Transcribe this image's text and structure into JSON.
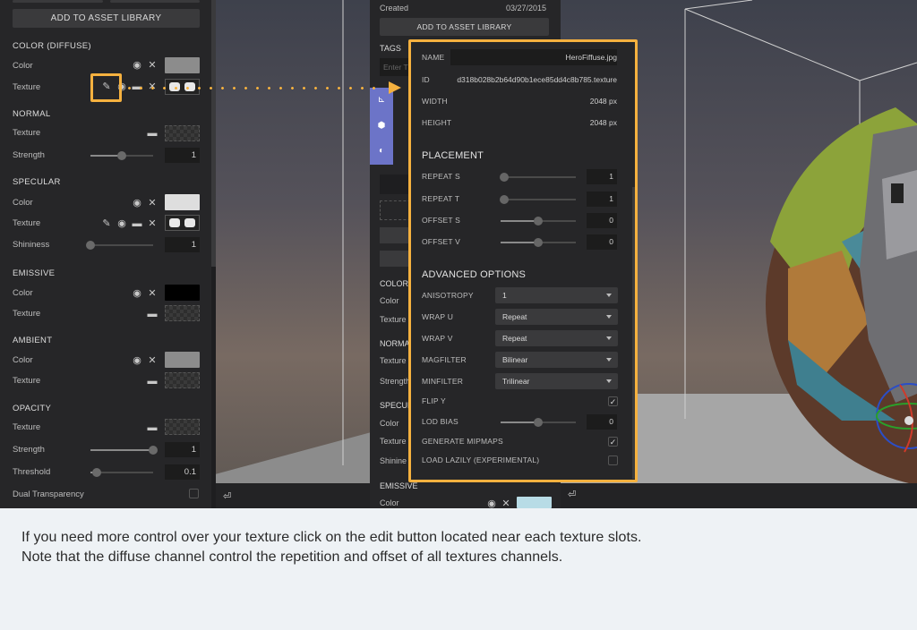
{
  "left_panel": {
    "add_to_library": "ADD TO ASSET LIBRARY",
    "sections": {
      "color_diffuse": "COLOR (DIFFUSE)",
      "normal": "NORMAL",
      "specular": "SPECULAR",
      "emissive": "EMISSIVE",
      "ambient": "AMBIENT",
      "opacity": "OPACITY"
    },
    "labels": {
      "color": "Color",
      "texture": "Texture",
      "strength": "Strength",
      "shininess": "Shininess",
      "threshold": "Threshold",
      "dual_transparency": "Dual Transparency"
    },
    "values": {
      "normal_strength": "1",
      "specular_shininess": "1",
      "opacity_strength": "1",
      "opacity_threshold": "0.1"
    },
    "slider_levels": {
      "normal_strength": 0.5,
      "specular_shininess": 0.0,
      "opacity_strength": 1.0,
      "opacity_threshold": 0.1
    },
    "swatch_colors": {
      "diffuse": "#8c8c8c",
      "specular": "#dedede",
      "emissive": "#000000",
      "ambient": "#8c8c8c"
    }
  },
  "middle_panel": {
    "created_label": "Created",
    "created_date": "03/27/2015",
    "add_to_library": "ADD TO ASSET LIBRARY",
    "tags_label": "TAGS",
    "tags_placeholder": "Enter T",
    "fragments": {
      "color": "COLOR",
      "color_row": "Color",
      "texture": "Texture",
      "normal": "NORMA",
      "texture2": "Texture",
      "strength": "Strength",
      "specular": "SPECUL",
      "color2": "Color",
      "texture3": "Texture",
      "shininess": "Shinine",
      "emissive": "EMISSIVE",
      "emissive_color": "Color"
    },
    "side_icons": [
      "axis-icon",
      "cube-icon",
      "material-icon"
    ]
  },
  "texture_popup": {
    "name_label": "NAME",
    "name_value": "HeroFiffuse.jpg",
    "id_label": "ID",
    "id_value": "d318b028b2b64d90b1ece85dd4c8b785.texture",
    "width_label": "WIDTH",
    "width_value": "2048 px",
    "height_label": "HEIGHT",
    "height_value": "2048 px",
    "placement_title": "PLACEMENT",
    "repeat_s_label": "REPEAT S",
    "repeat_s_value": "1",
    "repeat_t_label": "REPEAT T",
    "repeat_t_value": "1",
    "offset_s_label": "OFFSET S",
    "offset_s_value": "0",
    "offset_v_label": "OFFSET V",
    "offset_v_value": "0",
    "advanced_title": "ADVANCED OPTIONS",
    "anisotropy_label": "ANISOTROPY",
    "anisotropy_value": "1",
    "wrap_u_label": "WRAP U",
    "wrap_u_value": "Repeat",
    "wrap_v_label": "WRAP V",
    "wrap_v_value": "Repeat",
    "magfilter_label": "MAGFILTER",
    "magfilter_value": "Bilinear",
    "minfilter_label": "MINFILTER",
    "minfilter_value": "Trilinear",
    "flip_y_label": "FLIP Y",
    "flip_y_checked": true,
    "lod_bias_label": "LOD BIAS",
    "lod_bias_value": "0",
    "generate_mipmaps_label": "GENERATE MIPMAPS",
    "generate_mipmaps_checked": true,
    "load_lazily_label": "LOAD LAZILY (EXPERIMENTAL)",
    "load_lazily_checked": false,
    "check_glyph": "✓"
  },
  "caption": {
    "line1": "If you need more control over your texture click on the edit button located near each texture slots.",
    "line2": "Note that the diffuse channel control the repetition and offset of all textures channels."
  },
  "accent_color": "#f5b13f",
  "sidebar_accent": "#6c74c8"
}
